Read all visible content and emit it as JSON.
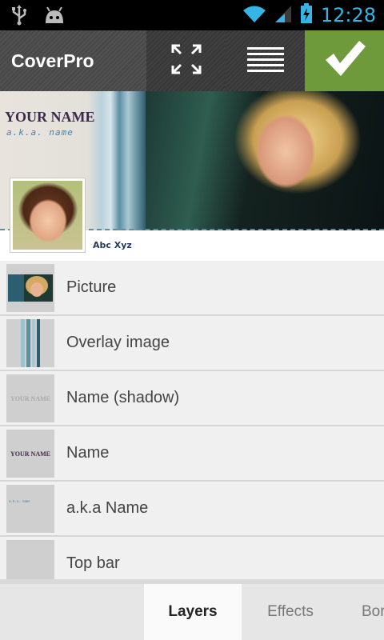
{
  "status_bar": {
    "time": "12:28",
    "icons": [
      "usb-icon",
      "android-debug-icon",
      "wifi-icon",
      "signal-icon",
      "battery-charging-icon"
    ],
    "accent_color": "#35b5e5"
  },
  "action_bar": {
    "title": "CoverPro",
    "actions": [
      "fullscreen-icon",
      "menu-icon",
      "confirm-check-icon"
    ],
    "confirm_color": "#6f9a3c"
  },
  "preview": {
    "name": "YOUR NAME",
    "aka": "a.k.a. name",
    "profile_name": "Abc Xyz"
  },
  "layers": [
    {
      "label": "Picture",
      "thumb_text": ""
    },
    {
      "label": "Overlay image",
      "thumb_text": ""
    },
    {
      "label": "Name (shadow)",
      "thumb_text": "YOUR NAME"
    },
    {
      "label": "Name",
      "thumb_text": "YOUR NAME"
    },
    {
      "label": "a.k.a Name",
      "thumb_text": "a.k.a. name"
    },
    {
      "label": "Top bar",
      "thumb_text": ""
    }
  ],
  "tabs": [
    {
      "label": "Layers",
      "active": true
    },
    {
      "label": "Effects",
      "active": false
    },
    {
      "label": "Bor",
      "active": false
    }
  ]
}
